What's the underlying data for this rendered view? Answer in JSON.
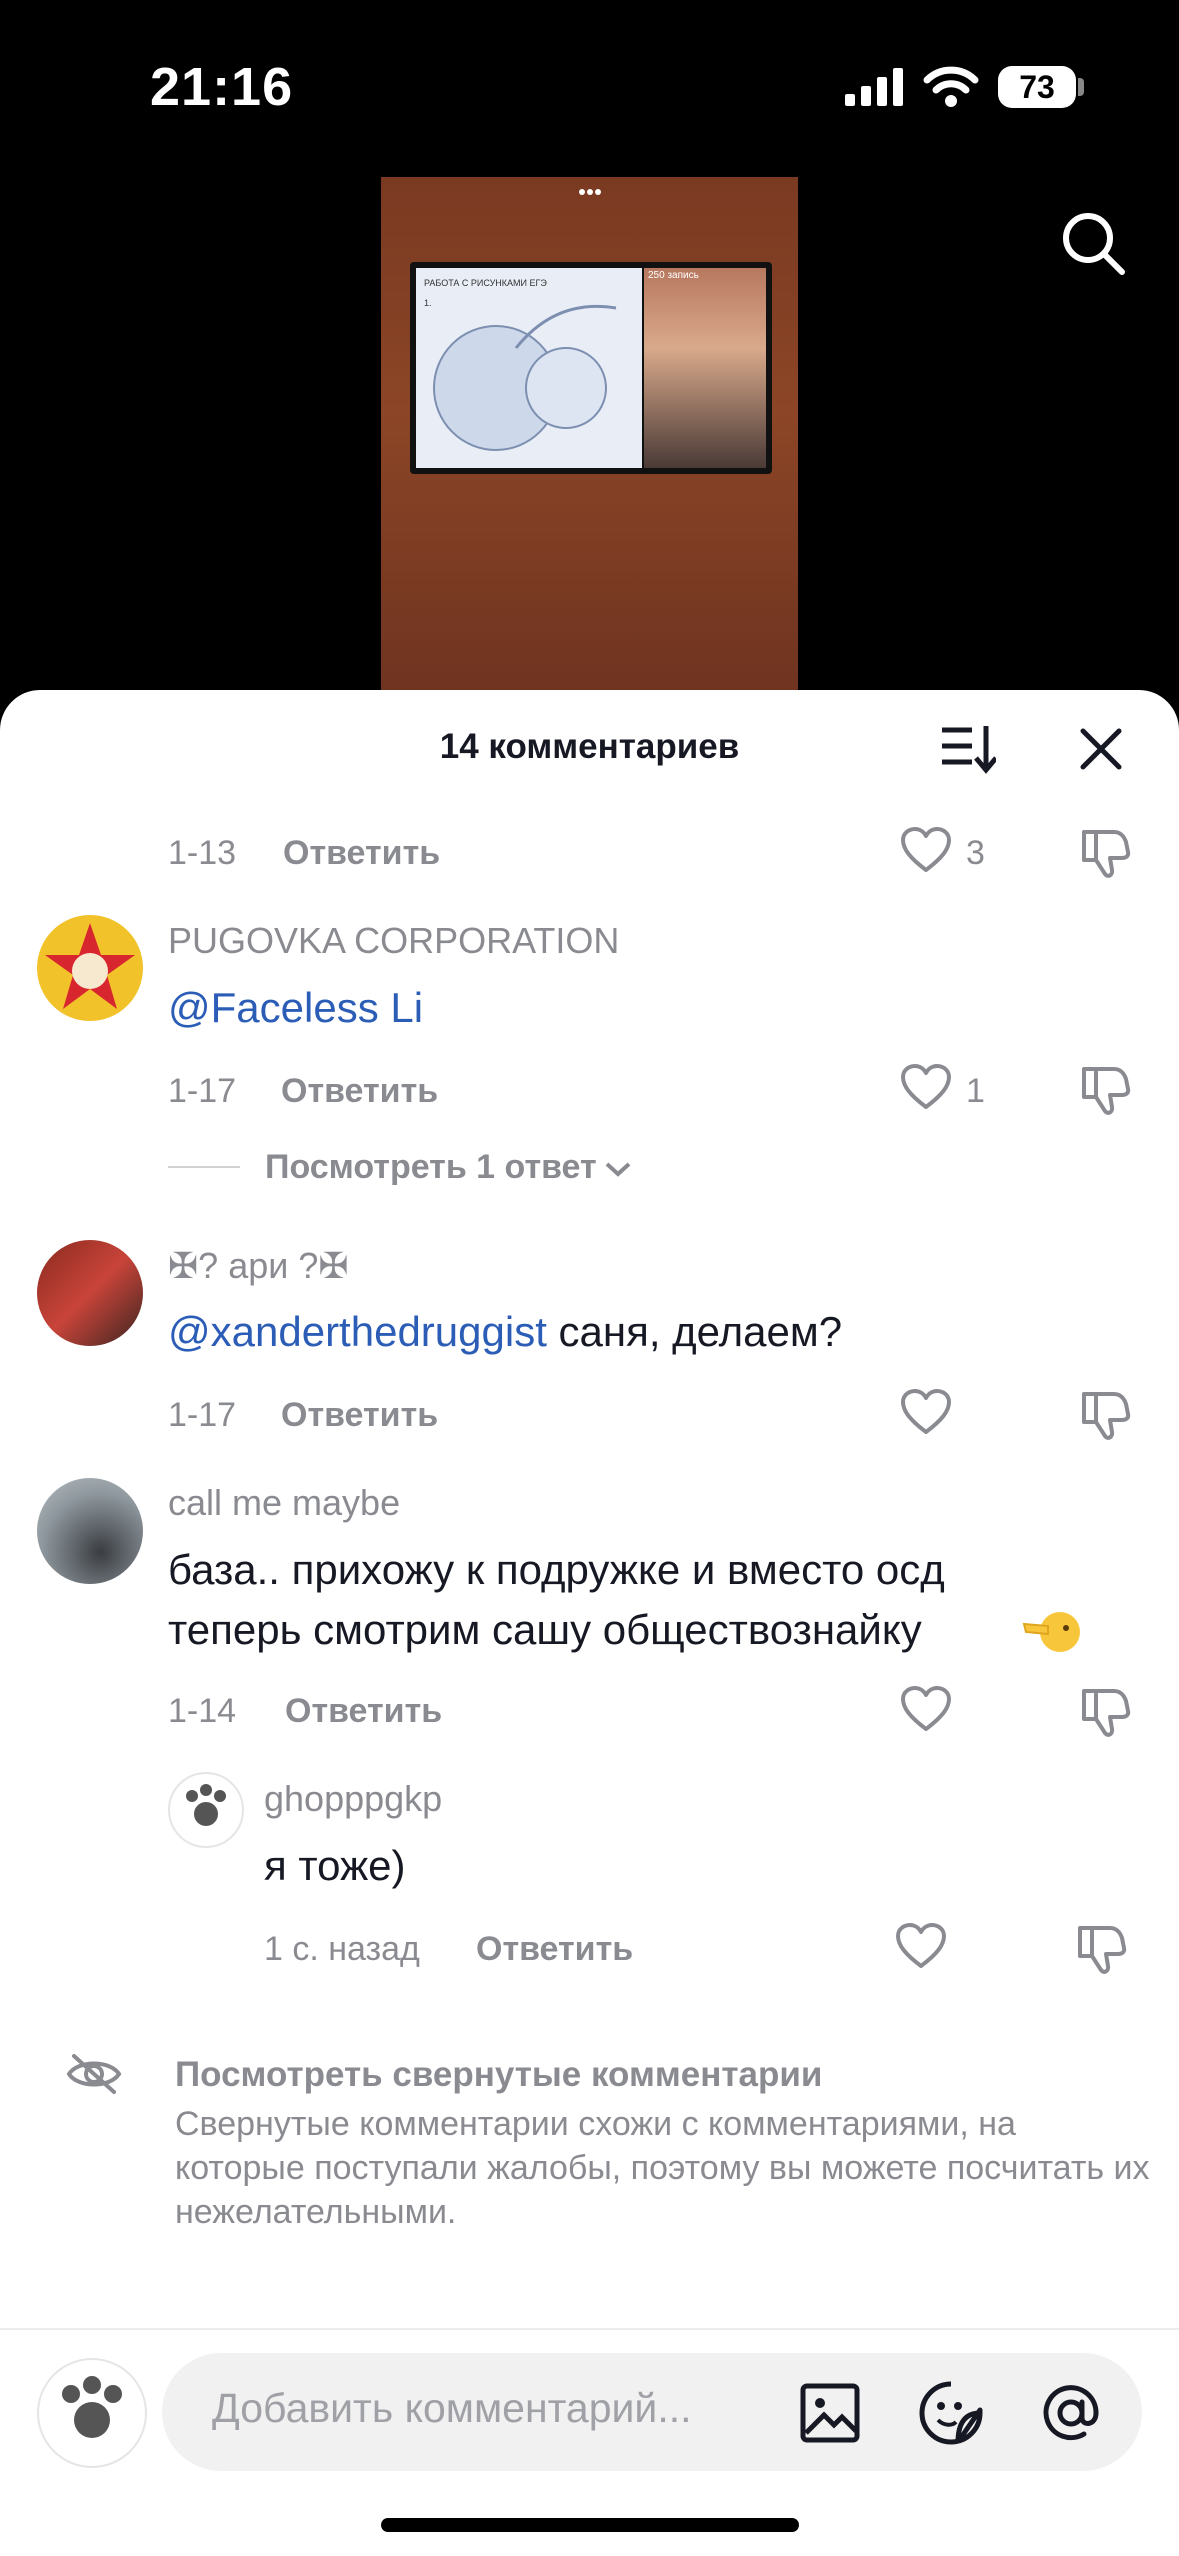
{
  "status_bar": {
    "time": "21:16",
    "battery": "73"
  },
  "video": {
    "slide_title": "РАБОТА С РИСУНКАМИ ЕГЭ",
    "slide_num": "1.",
    "overlay_text": "250 запись"
  },
  "header": {
    "title": "14 комментариев"
  },
  "comments": [
    {
      "date": "1-13",
      "reply_label": "Ответить",
      "likes": "3"
    },
    {
      "username": "PUGOVKA CORPORATION",
      "mention": "@Faceless Li",
      "text": "",
      "date": "1-17",
      "reply_label": "Ответить",
      "likes": "1",
      "view_replies": "Посмотреть 1 ответ"
    },
    {
      "username": "✠? ари ?✠",
      "mention": "@xanderthedruggist",
      "text": " саня, делаем?",
      "date": "1-17",
      "reply_label": "Ответить"
    },
    {
      "username": "call me maybe",
      "text_line1": "база.. прихожу к подружке и вместо осд",
      "text_line2": "теперь смотрим сашу обществознайку",
      "date": "1-14",
      "reply_label": "Ответить"
    },
    {
      "username": "ghopppgkp",
      "text": "я тоже)",
      "date": "1 с. назад",
      "reply_label": "Ответить"
    }
  ],
  "hidden_comments": {
    "title": "Посмотреть свернутые комментарии",
    "description": "Свернутые комментарии схожи с комментариями, на которые поступали жалобы, поэтому вы можете посчитать их нежелательными."
  },
  "composer": {
    "placeholder": "Добавить комментарий..."
  },
  "colors": {
    "mention": "#2b5db7",
    "muted": "#8a8b91",
    "text": "#161823"
  }
}
